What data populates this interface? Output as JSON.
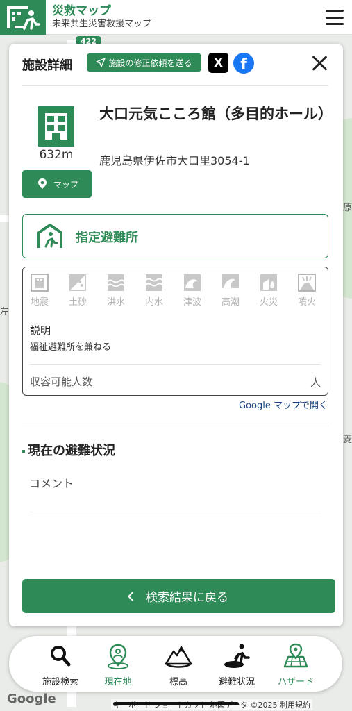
{
  "header": {
    "title": "災救マップ",
    "subtitle": "未来共生災害救援マップ"
  },
  "map": {
    "route_badge": "422",
    "edge_texts": [
      "原",
      "菱",
      "左"
    ],
    "attribution": "キーボード ショートカット  地図データ ©2025  利用規約",
    "google": "Google"
  },
  "panel": {
    "title": "施設詳細",
    "fix_request_label": "施設の修正依頼を送る",
    "x_label": "X",
    "fb_label": "f",
    "facility": {
      "name": "大口元気こころ館（多目的ホール）",
      "distance": "632m",
      "address": "鹿児島県伊佐市大口里3054-1",
      "map_button_label": "マップ"
    },
    "shelter_label": "指定避難所",
    "hazards": [
      "地震",
      "土砂",
      "洪水",
      "内水",
      "津波",
      "高潮",
      "火災",
      "噴火"
    ],
    "description_label": "説明",
    "description_text": "福祉避難所を兼ねる",
    "capacity_label": "収容可能人数",
    "capacity_unit": "人",
    "google_map_link": "Google マップで開く",
    "status_title": "現在の避難状況",
    "comment_label": "コメント",
    "back_button_label": "検索結果に戻る"
  },
  "bottom_nav": [
    {
      "label": "施設検索",
      "icon": "search-icon"
    },
    {
      "label": "現在地",
      "icon": "location-icon"
    },
    {
      "label": "標高",
      "icon": "mountain-icon"
    },
    {
      "label": "避難状況",
      "icon": "evacuation-icon"
    },
    {
      "label": "ハザード",
      "icon": "hazard-map-icon"
    }
  ],
  "colors": {
    "brand": "#2e8b57",
    "inactive_hazard": "#b5b5b5"
  }
}
